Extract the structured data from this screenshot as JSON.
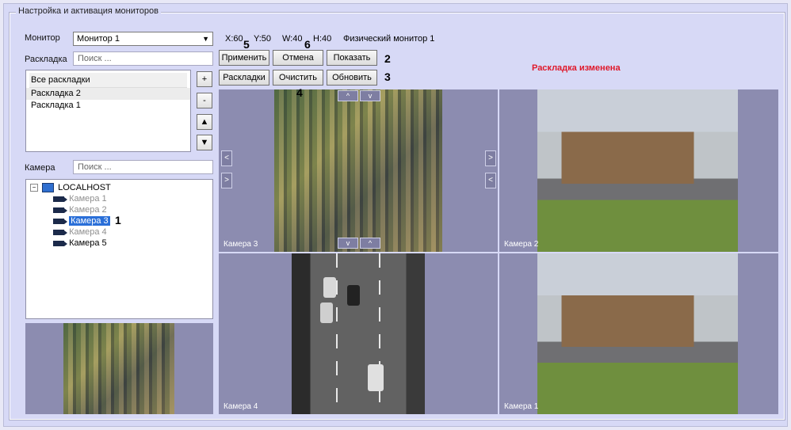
{
  "group_title": "Настройка и активация мониторов",
  "monitor": {
    "label": "Монитор",
    "value": "Монитор 1"
  },
  "layout": {
    "label": "Раскладка",
    "search_placeholder": "Поиск ...",
    "list_header": "Все раскладки",
    "items": [
      "Раскладка 2",
      "Раскладка 1"
    ]
  },
  "camera": {
    "label": "Камера",
    "search_placeholder": "Поиск ..."
  },
  "tree": {
    "root": "LOCALHOST",
    "items": [
      {
        "label": "Камера 1",
        "enabled": false
      },
      {
        "label": "Камера 2",
        "enabled": false
      },
      {
        "label": "Камера 3",
        "enabled": true,
        "selected": true
      },
      {
        "label": "Камера 4",
        "enabled": false
      },
      {
        "label": "Камера 5",
        "enabled": true
      }
    ]
  },
  "side_buttons": {
    "add": "+",
    "remove": "-",
    "up": "▲",
    "down": "▼"
  },
  "coords": {
    "x": "X:60",
    "y": "Y:50",
    "w": "W:40",
    "h": "H:40",
    "physical": "Физический монитор 1"
  },
  "buttons": {
    "apply": "Применить",
    "cancel": "Отмена",
    "show": "Показать",
    "layouts": "Раскладки",
    "clear": "Очистить",
    "refresh": "Обновить"
  },
  "annotations": {
    "n1": "1",
    "n2": "2",
    "n3": "3",
    "n4": "4",
    "n5": "5",
    "n6": "6"
  },
  "status": {
    "text": "Раскладка изменена",
    "color": "#e0182a"
  },
  "cells": [
    {
      "label": "Камера 3"
    },
    {
      "label": "Камера 2"
    },
    {
      "label": "Камера 4"
    },
    {
      "label": "Камера 1"
    }
  ],
  "nav": {
    "left": "<",
    "right": ">",
    "up": "^",
    "down": "v"
  }
}
